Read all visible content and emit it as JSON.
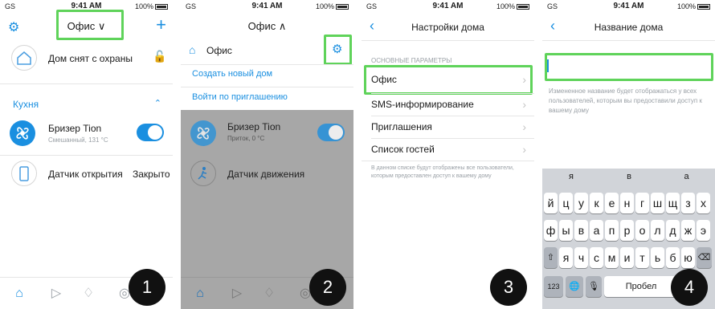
{
  "status": {
    "carrier": "GS",
    "time": "9:41 AM",
    "battery": "100%"
  },
  "screen1": {
    "title": "Офис ∨",
    "plus": "+",
    "security": "Дом снят с охраны",
    "room": "Кухня",
    "device1_name": "Бризер Tion",
    "device1_sub": "Смешанный, 131 °C",
    "device2_name": "Датчик открытия",
    "device2_status": "Закрыто",
    "badge": "1"
  },
  "screen2": {
    "title": "Офис ∧",
    "home": "Офис",
    "create": "Создать новый дом",
    "invite": "Войти по приглашению",
    "device1_name": "Бризер Tion",
    "device1_sub": "Приток, 0 °C",
    "device2_name": "Датчик движения",
    "badge": "2"
  },
  "screen3": {
    "title": "Настройки дома",
    "section": "ОСНОВНЫЕ ПАРАМЕТРЫ",
    "rows": [
      "Офис",
      "SMS-информирование",
      "Приглашения",
      "Список гостей"
    ],
    "note": "В данном списке будут отображены все пользователи, которым предоставлен доступ к вашему дому",
    "badge": "3"
  },
  "screen4": {
    "title": "Название дома",
    "hint": "Измененное название будет отображаться у всех пользователей, которым вы предоставили доступ к вашему дому",
    "suggestions": [
      "я",
      "в",
      "а"
    ],
    "row1": [
      "й",
      "ц",
      "у",
      "к",
      "е",
      "н",
      "г",
      "ш",
      "щ",
      "з",
      "х"
    ],
    "row2": [
      "ф",
      "ы",
      "в",
      "а",
      "п",
      "р",
      "о",
      "л",
      "д",
      "ж",
      "э"
    ],
    "row3": [
      "я",
      "ч",
      "с",
      "м",
      "и",
      "т",
      "ь",
      "б",
      "ю"
    ],
    "numkey": "123",
    "space": "Пробел",
    "badge": "4"
  },
  "colors": {
    "accent": "#1a8fe0",
    "highlight": "#5fd35a"
  }
}
